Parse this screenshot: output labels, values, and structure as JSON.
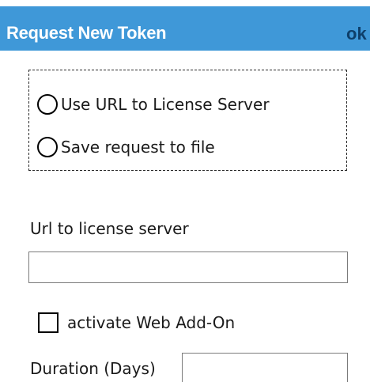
{
  "header": {
    "title": "Request New Token",
    "ok_label": "ok"
  },
  "request_mode": {
    "options": [
      {
        "label": "Use URL to License Server",
        "selected": false
      },
      {
        "label": "Save request to file",
        "selected": false
      }
    ]
  },
  "url_field": {
    "label": "Url to license server",
    "value": ""
  },
  "web_addon": {
    "label": "activate Web Add-On",
    "checked": false
  },
  "duration": {
    "label": "Duration (Days)",
    "value": ""
  },
  "colors": {
    "title_bar": "#3f98d8",
    "title_text": "#ffffff",
    "ok_text": "#0e3f6a"
  }
}
